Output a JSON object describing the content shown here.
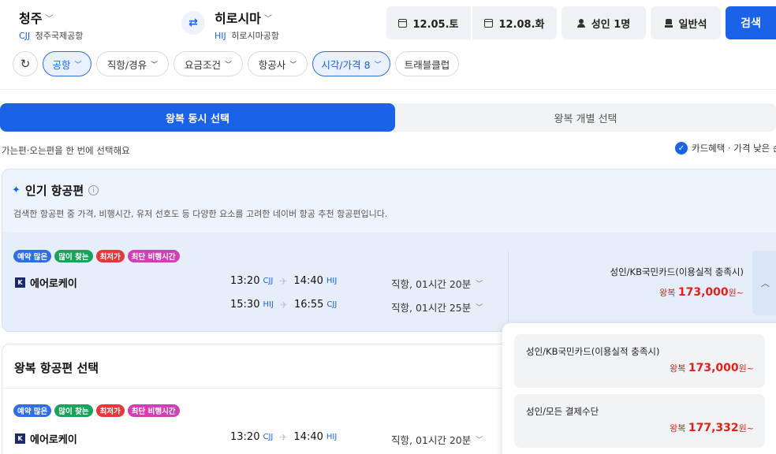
{
  "header": {
    "origin": {
      "city": "청주",
      "code": "CJJ",
      "airport": "청주국제공항"
    },
    "destination": {
      "city": "히로시마",
      "code": "HIJ",
      "airport": "히로시마공항"
    },
    "depart_date": "12.05.토",
    "return_date": "12.08.화",
    "passengers": "성인 1명",
    "cabin": "일반석",
    "search_label": "검색"
  },
  "filters": [
    {
      "label": "공항",
      "active": true
    },
    {
      "label": "직항/경유",
      "active": false
    },
    {
      "label": "요금조건",
      "active": false
    },
    {
      "label": "항공사",
      "active": false
    },
    {
      "label": "시각/가격 8",
      "active": true
    },
    {
      "label": "트래블클럽",
      "active": false
    }
  ],
  "tabs": {
    "roundtrip_together": "왕복 동시 선택",
    "roundtrip_separate": "왕복 개별 선택"
  },
  "subline": "가는편·오는편을 한 번에 선택해요",
  "card_option": "카드혜택 · 가격 낮은 순",
  "popular": {
    "title": "인기 항공편",
    "description": "검색한 항공편 중 가격, 비행시간, 유저 선호도 등 다양한 요소를 고려한 네이버 항공 추천 항공편입니다.",
    "badges": [
      "예약 많은",
      "많이 찾는",
      "최저가",
      "최단 비행시간"
    ],
    "airline": "에어로케이",
    "legs": [
      {
        "dep_time": "13:20",
        "dep_code": "CJJ",
        "arr_time": "14:40",
        "arr_code": "HIJ",
        "duration": "직항, 01시간 20분"
      },
      {
        "dep_time": "15:30",
        "dep_code": "HIJ",
        "arr_time": "16:55",
        "arr_code": "CJJ",
        "duration": "직항, 01시간 25분"
      }
    ],
    "price_label": "성인/KB국민카드(이용실적 충족시)",
    "price_prefix": "왕복",
    "price": "173,000",
    "price_suffix": "원~"
  },
  "roundtrip_section": {
    "title": "왕복 항공편 선택",
    "badges": [
      "예약 많은",
      "많이 찾는",
      "최저가",
      "최단 비행시간"
    ],
    "airline": "에어로케이",
    "leg": {
      "dep_time": "13:20",
      "dep_code": "CJJ",
      "arr_time": "14:40",
      "arr_code": "HIJ",
      "duration": "직항, 01시간 20분"
    }
  },
  "price_popup": [
    {
      "label": "성인/KB국민카드(이용실적 충족시)",
      "prefix": "왕복",
      "price": "173,000",
      "suffix": "원~"
    },
    {
      "label": "성인/모든 결제수단",
      "prefix": "왕복",
      "price": "177,332",
      "suffix": "원~"
    }
  ],
  "colors": {
    "accent": "#1a62e8",
    "price": "#e0201b"
  }
}
